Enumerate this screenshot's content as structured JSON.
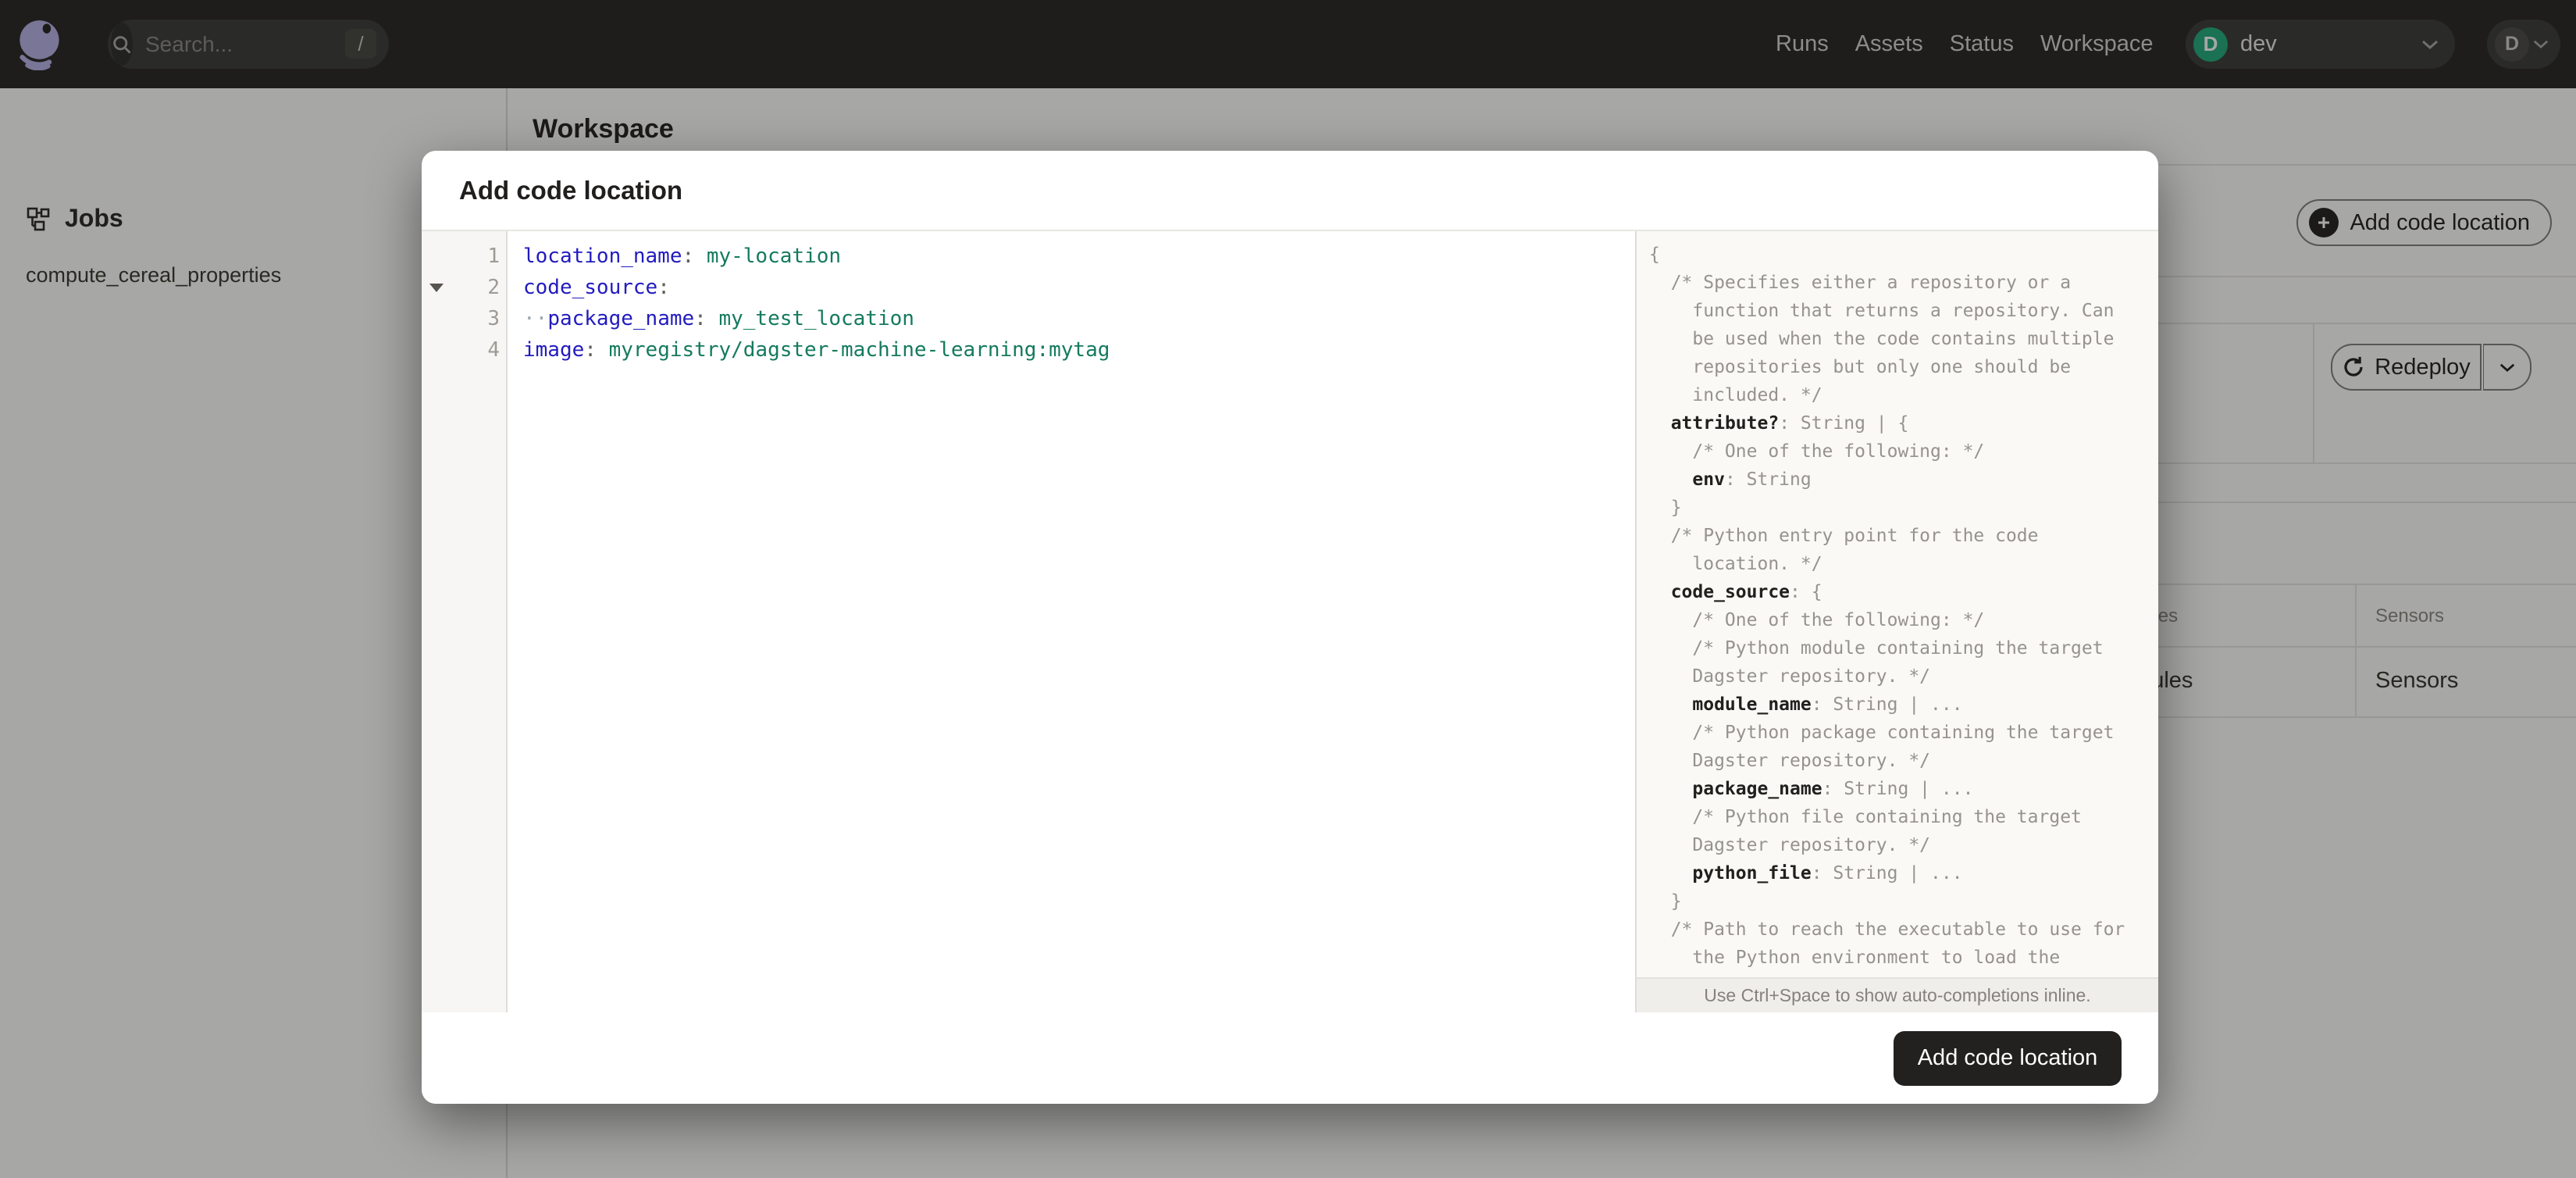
{
  "colors": {
    "nav_bg": "#262524",
    "accent_green": "#21aa7d",
    "editor_key": "#221bbf",
    "editor_value": "#157a5e",
    "editor_punct": "#5f5d59",
    "schema_key": "#21201d",
    "schema_text": "#96938e"
  },
  "nav": {
    "search_placeholder": "Search...",
    "search_shortcut": "/",
    "links": [
      {
        "label": "Runs"
      },
      {
        "label": "Assets"
      },
      {
        "label": "Status"
      },
      {
        "label": "Workspace"
      }
    ],
    "deployment": {
      "initial": "D",
      "name": "dev"
    },
    "user": {
      "initial": "D"
    }
  },
  "sidebar": {
    "section_title": "Jobs",
    "items": [
      {
        "label": "compute_cereal_properties"
      }
    ]
  },
  "page": {
    "title": "Workspace",
    "add_code_location_label": "Add code location",
    "redeploy_label": "Redeploy",
    "table": {
      "headers": [
        "Schedules",
        "Sensors"
      ],
      "row": [
        "Schedules",
        "Sensors"
      ]
    }
  },
  "modal": {
    "title": "Add code location",
    "submit_label": "Add code location",
    "hint": "Use Ctrl+Space to show auto-completions inline.",
    "editor": {
      "lines": [
        {
          "num": "1",
          "fold": false,
          "tokens": [
            [
              "key",
              "location_name"
            ],
            [
              "punc",
              ":"
            ],
            [
              "sp",
              " "
            ],
            [
              "val",
              "my-location"
            ]
          ]
        },
        {
          "num": "2",
          "fold": true,
          "tokens": [
            [
              "key",
              "code_source"
            ],
            [
              "punc",
              ":"
            ]
          ]
        },
        {
          "num": "3",
          "fold": false,
          "tokens": [
            [
              "ind",
              "··"
            ],
            [
              "key",
              "package_name"
            ],
            [
              "punc",
              ":"
            ],
            [
              "sp",
              " "
            ],
            [
              "val",
              "my_test_location"
            ]
          ]
        },
        {
          "num": "4",
          "fold": false,
          "tokens": [
            [
              "key",
              "image"
            ],
            [
              "punc",
              ":"
            ],
            [
              "sp",
              " "
            ],
            [
              "val",
              "myregistry/dagster-machine-learning:mytag"
            ]
          ]
        }
      ]
    },
    "schema": {
      "lines": [
        [
          [
            0,
            "{"
          ]
        ],
        [
          [
            0,
            "  /* Specifies either a repository or a"
          ]
        ],
        [
          [
            0,
            "    function that returns a repository. Can"
          ]
        ],
        [
          [
            0,
            "    be used when the code contains multiple"
          ]
        ],
        [
          [
            0,
            "    repositories but only one should be"
          ]
        ],
        [
          [
            0,
            "    included. */"
          ]
        ],
        [
          [
            0,
            "  "
          ],
          [
            1,
            "attribute?"
          ],
          [
            0,
            ": String | {"
          ]
        ],
        [
          [
            0,
            "    /* One of the following: */"
          ]
        ],
        [
          [
            0,
            "    "
          ],
          [
            1,
            "env"
          ],
          [
            0,
            ": String"
          ]
        ],
        [
          [
            0,
            "  }"
          ]
        ],
        [
          [
            0,
            "  /* Python entry point for the code"
          ]
        ],
        [
          [
            0,
            "    location. */"
          ]
        ],
        [
          [
            0,
            "  "
          ],
          [
            1,
            "code_source"
          ],
          [
            0,
            ": {"
          ]
        ],
        [
          [
            0,
            "    /* One of the following: */"
          ]
        ],
        [
          [
            0,
            "    /* Python module containing the target"
          ]
        ],
        [
          [
            0,
            "    Dagster repository. */"
          ]
        ],
        [
          [
            0,
            "    "
          ],
          [
            1,
            "module_name"
          ],
          [
            0,
            ": String | ..."
          ]
        ],
        [
          [
            0,
            "    /* Python package containing the target"
          ]
        ],
        [
          [
            0,
            "    Dagster repository. */"
          ]
        ],
        [
          [
            0,
            "    "
          ],
          [
            1,
            "package_name"
          ],
          [
            0,
            ": String | ..."
          ]
        ],
        [
          [
            0,
            "    /* Python file containing the target"
          ]
        ],
        [
          [
            0,
            "    Dagster repository. */"
          ]
        ],
        [
          [
            0,
            "    "
          ],
          [
            1,
            "python_file"
          ],
          [
            0,
            ": String | ..."
          ]
        ],
        [
          [
            0,
            "  }"
          ]
        ],
        [
          [
            0,
            "  /* Path to reach the executable to use for"
          ]
        ],
        [
          [
            0,
            "    the Python environment to load the"
          ]
        ]
      ]
    }
  }
}
